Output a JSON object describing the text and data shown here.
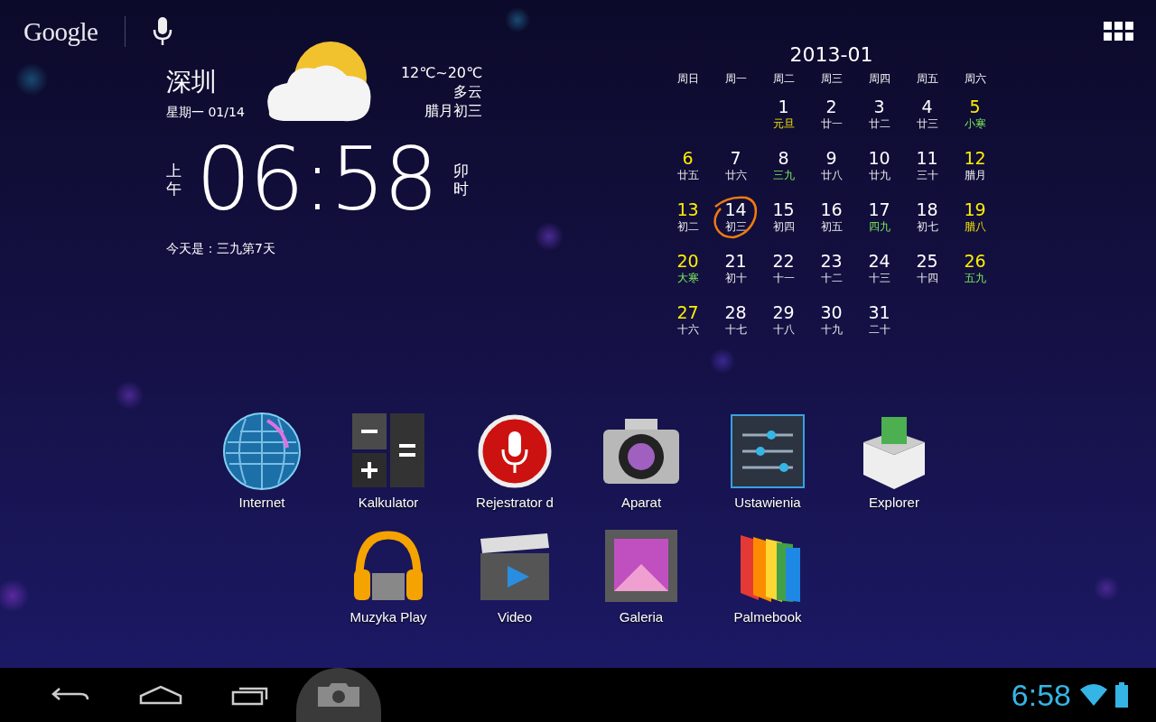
{
  "search_bar": {
    "logo": "Google"
  },
  "weather": {
    "city": "深圳",
    "date": "星期一 01/14",
    "temperature": "12℃~20℃",
    "condition": "多云",
    "lunar_date": "腊月初三",
    "meridiem": "上午",
    "time": "06:58",
    "shichen": "卯时",
    "note": "今天是：三九第7天"
  },
  "calendar": {
    "title": "2013-01",
    "weekdays": [
      "周日",
      "周一",
      "周二",
      "周三",
      "周四",
      "周五",
      "周六"
    ],
    "weeks": [
      {
        "days": [
          {
            "day": "1",
            "lunar": "元旦",
            "weekend": false,
            "kind": "festival",
            "selected": false
          },
          {
            "day": "2",
            "lunar": "廿一",
            "weekend": false,
            "kind": "plain",
            "selected": false
          },
          {
            "day": "3",
            "lunar": "廿二",
            "weekend": false,
            "kind": "plain",
            "selected": false
          },
          {
            "day": "4",
            "lunar": "廿三",
            "weekend": false,
            "kind": "plain",
            "selected": false
          },
          {
            "day": "5",
            "lunar": "小寒",
            "weekend": true,
            "kind": "term",
            "selected": false
          }
        ]
      },
      {
        "days": [
          {
            "day": "6",
            "lunar": "廿五",
            "weekend": true,
            "kind": "plain",
            "selected": false
          },
          {
            "day": "7",
            "lunar": "廿六",
            "weekend": false,
            "kind": "plain",
            "selected": false
          },
          {
            "day": "8",
            "lunar": "三九",
            "weekend": false,
            "kind": "term",
            "selected": false
          },
          {
            "day": "9",
            "lunar": "廿八",
            "weekend": false,
            "kind": "plain",
            "selected": false
          },
          {
            "day": "10",
            "lunar": "廿九",
            "weekend": false,
            "kind": "plain",
            "selected": false
          },
          {
            "day": "11",
            "lunar": "三十",
            "weekend": false,
            "kind": "plain",
            "selected": false
          },
          {
            "day": "12",
            "lunar": "腊月",
            "weekend": true,
            "kind": "plain",
            "selected": false
          }
        ]
      },
      {
        "days": [
          {
            "day": "13",
            "lunar": "初二",
            "weekend": true,
            "kind": "plain",
            "selected": false
          },
          {
            "day": "14",
            "lunar": "初三",
            "weekend": false,
            "kind": "plain",
            "selected": true
          },
          {
            "day": "15",
            "lunar": "初四",
            "weekend": false,
            "kind": "plain",
            "selected": false
          },
          {
            "day": "16",
            "lunar": "初五",
            "weekend": false,
            "kind": "plain",
            "selected": false
          },
          {
            "day": "17",
            "lunar": "四九",
            "weekend": false,
            "kind": "term",
            "selected": false
          },
          {
            "day": "18",
            "lunar": "初七",
            "weekend": false,
            "kind": "plain",
            "selected": false
          },
          {
            "day": "19",
            "lunar": "腊八",
            "weekend": true,
            "kind": "festival",
            "selected": false
          }
        ]
      },
      {
        "days": [
          {
            "day": "20",
            "lunar": "大寒",
            "weekend": true,
            "kind": "term",
            "selected": false
          },
          {
            "day": "21",
            "lunar": "初十",
            "weekend": false,
            "kind": "plain",
            "selected": false
          },
          {
            "day": "22",
            "lunar": "十一",
            "weekend": false,
            "kind": "plain",
            "selected": false
          },
          {
            "day": "23",
            "lunar": "十二",
            "weekend": false,
            "kind": "plain",
            "selected": false
          },
          {
            "day": "24",
            "lunar": "十三",
            "weekend": false,
            "kind": "plain",
            "selected": false
          },
          {
            "day": "25",
            "lunar": "十四",
            "weekend": false,
            "kind": "plain",
            "selected": false
          },
          {
            "day": "26",
            "lunar": "五九",
            "weekend": true,
            "kind": "term",
            "selected": false
          }
        ]
      },
      {
        "days": [
          {
            "day": "27",
            "lunar": "十六",
            "weekend": true,
            "kind": "plain",
            "selected": false
          },
          {
            "day": "28",
            "lunar": "十七",
            "weekend": false,
            "kind": "plain",
            "selected": false
          },
          {
            "day": "29",
            "lunar": "十八",
            "weekend": false,
            "kind": "plain",
            "selected": false
          },
          {
            "day": "30",
            "lunar": "十九",
            "weekend": false,
            "kind": "plain",
            "selected": false
          },
          {
            "day": "31",
            "lunar": "二十",
            "weekend": false,
            "kind": "plain",
            "selected": false
          }
        ]
      }
    ]
  },
  "apps": [
    {
      "label": "Internet",
      "kind": "globe"
    },
    {
      "label": "Kalkulator",
      "kind": "calculator"
    },
    {
      "label": "Rejestrator d",
      "kind": "microphone"
    },
    {
      "label": "Aparat",
      "kind": "camera"
    },
    {
      "label": "Ustawienia",
      "kind": "sliders"
    },
    {
      "label": "Explorer",
      "kind": "box"
    },
    {
      "label": "Muzyka Play",
      "kind": "headphones"
    },
    {
      "label": "Video",
      "kind": "clapperboard"
    },
    {
      "label": "Galeria",
      "kind": "picture"
    },
    {
      "label": "Palmebook",
      "kind": "book"
    }
  ],
  "status_bar": {
    "time": "6:58"
  }
}
